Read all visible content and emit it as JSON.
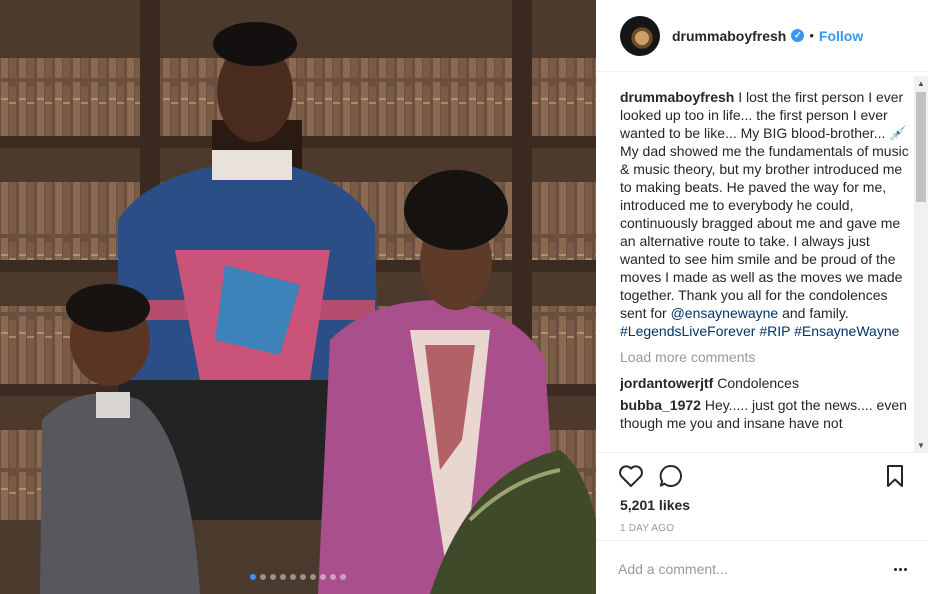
{
  "post": {
    "photo_alt": "Family portrait in front of bookshelves",
    "carousel_count": 10,
    "carousel_active": 1
  },
  "header": {
    "username": "drummaboyfresh",
    "verified_icon": "verified-badge-icon",
    "bullet": "•",
    "follow_label": "Follow"
  },
  "caption": {
    "username": "drummaboyfresh",
    "text_part1": "I lost the first person I ever looked up too in life... the first person I ever wanted to be like... My BIG blood-brother... 💉 My dad showed me the fundamentals of music & music theory, but my brother introduced me to making beats. He paved the way for me, introduced me to everybody he could, continuously bragged about me and gave me an alternative route to take. I always just wanted to see him smile and be proud of the moves I made as well as the moves we made together. Thank you all for the condolences sent for",
    "mention": "@ensaynewayne",
    "text_part2": "and family.",
    "hashtags": [
      "#LegendsLiveForever",
      "#RIP",
      "#EnsayneWayne"
    ]
  },
  "load_more": "Load more comments",
  "comments": [
    {
      "username": "jordantowerjtf",
      "text": "Condolences"
    },
    {
      "username": "bubba_1972",
      "text": "Hey..... just got the news.... even though me you and insane have not"
    }
  ],
  "actions": {
    "like_icon": "heart-icon",
    "comment_icon": "comment-bubble-icon",
    "save_icon": "bookmark-icon",
    "likes": "5,201 likes",
    "time": "1 DAY AGO"
  },
  "add_comment": {
    "placeholder": "Add a comment...",
    "more_icon": "more-options-icon"
  },
  "colors": {
    "accent": "#3897f0",
    "link": "#003569",
    "muted": "#999999"
  }
}
